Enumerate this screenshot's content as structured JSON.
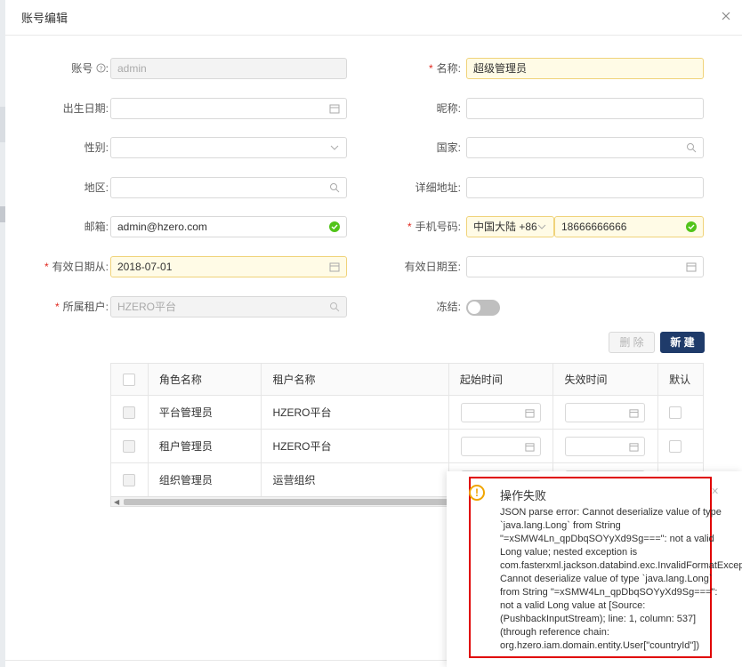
{
  "modal": {
    "title": "账号编辑"
  },
  "form": {
    "account": {
      "label": "账号",
      "value": "admin"
    },
    "name": {
      "label": "名称:",
      "value": "超级管理员"
    },
    "birthday": {
      "label": "出生日期:",
      "value": ""
    },
    "nickname": {
      "label": "昵称:",
      "value": ""
    },
    "gender": {
      "label": "性别:",
      "value": ""
    },
    "country": {
      "label": "国家:",
      "value": ""
    },
    "region": {
      "label": "地区:",
      "value": ""
    },
    "address": {
      "label": "详细地址:",
      "value": ""
    },
    "email": {
      "label": "邮箱:",
      "value": "admin@hzero.com"
    },
    "phone": {
      "label": "手机号码:",
      "code": "中国大陆 +86",
      "value": "18666666666"
    },
    "valid_from": {
      "label": "有效日期从:",
      "value": "2018-07-01"
    },
    "valid_to": {
      "label": "有效日期至:",
      "value": ""
    },
    "tenant": {
      "label": "所属租户:",
      "value": "HZERO平台"
    },
    "frozen": {
      "label": "冻结:",
      "value": false
    }
  },
  "toolbar": {
    "delete_label": "删 除",
    "new_label": "新 建"
  },
  "table": {
    "headers": [
      "角色名称",
      "租户名称",
      "起始时间",
      "失效时间",
      "默认"
    ],
    "rows": [
      {
        "role": "平台管理员",
        "tenant": "HZERO平台"
      },
      {
        "role": "租户管理员",
        "tenant": "HZERO平台"
      },
      {
        "role": "组织管理员",
        "tenant": "运营组织"
      }
    ]
  },
  "notification": {
    "title": "操作失败",
    "lines": [
      "JSON parse error: Cannot deserialize value of type",
      "`java.lang.Long` from String",
      "\"=xSMW4Ln_qpDbqSOYyXd9Sg===\": not a valid",
      "Long value; nested exception is",
      "com.fasterxml.jackson.databind.exc.InvalidFormatException:",
      "Cannot deserialize value of type `java.lang.Long`",
      "from String \"=xSMW4Ln_qpDbqSOYyXd9Sg===\":",
      "not a valid Long value at [Source:",
      "(PushbackInputStream); line: 1, column: 537]",
      "(through reference chain:",
      "org.hzero.iam.domain.entity.User[\"countryId\"])"
    ]
  },
  "colors": {
    "primary": "#1f3b6a",
    "required_bg": "#fffbe6",
    "error_border": "#e00000",
    "warn": "#f0a500",
    "success": "#52c41a"
  }
}
